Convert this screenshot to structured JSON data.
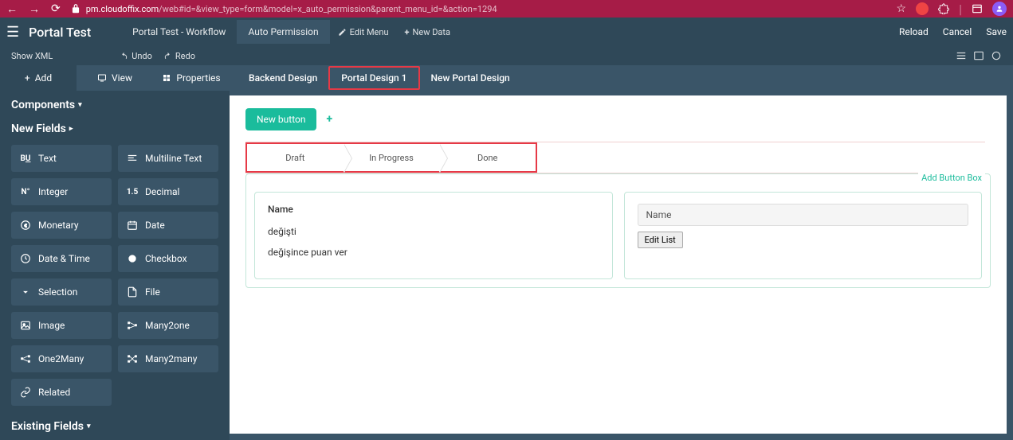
{
  "browser": {
    "url_domain": "pm.cloudoffix.com",
    "url_path": "/web#id=&view_type=form&model=x_auto_permission&parent_menu_id=&action=1294"
  },
  "app": {
    "title": "Portal Test",
    "nav": {
      "workflow": "Portal Test - Workflow",
      "auto_permission": "Auto Permission",
      "edit_menu": "Edit Menu",
      "new_data": "New Data"
    },
    "right": {
      "reload": "Reload",
      "cancel": "Cancel",
      "save": "Save"
    }
  },
  "secondary": {
    "show_xml": "Show XML",
    "undo": "Undo",
    "redo": "Redo"
  },
  "sidebar": {
    "tabs": {
      "add": "Add",
      "view": "View",
      "properties": "Properties"
    },
    "components_title": "Components",
    "new_fields_title": "New Fields",
    "existing_fields_title": "Existing Fields",
    "fields": {
      "text": "Text",
      "multiline": "Multiline Text",
      "integer": "Integer",
      "decimal": "Decimal",
      "monetary": "Monetary",
      "date": "Date",
      "datetime": "Date & Time",
      "checkbox": "Checkbox",
      "selection": "Selection",
      "file": "File",
      "image": "Image",
      "many2one": "Many2one",
      "one2many": "One2Many",
      "many2many": "Many2many",
      "related": "Related"
    }
  },
  "content": {
    "tabs": {
      "backend": "Backend Design",
      "portal1": "Portal Design 1",
      "new_portal": "New Portal Design"
    },
    "new_button": "New button",
    "statuses": {
      "draft": "Draft",
      "in_progress": "In Progress",
      "done": "Done"
    },
    "add_button_box": "Add Button Box",
    "left_card": {
      "name": "Name",
      "item1": "değişti",
      "item2": "değişince puan ver"
    },
    "right_card": {
      "name_header": "Name",
      "edit_list": "Edit List"
    }
  }
}
